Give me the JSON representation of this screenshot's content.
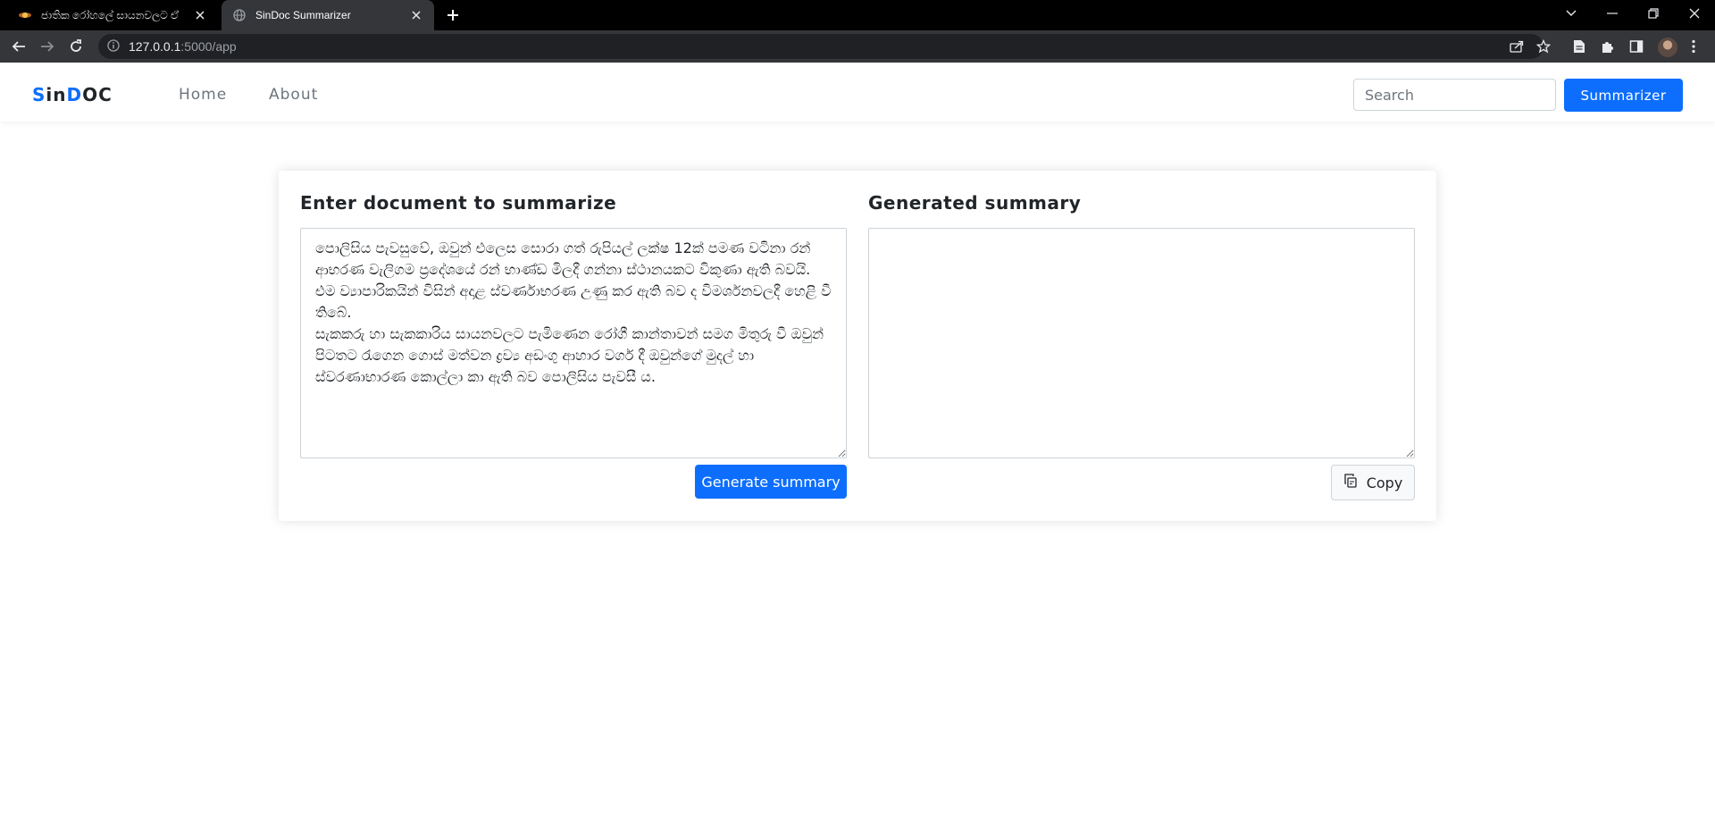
{
  "browser": {
    "tabs": [
      {
        "title": "ජාතික රෝහලේ සායනවලට ඒ",
        "active": false
      },
      {
        "title": "SinDoc Summarizer",
        "active": true
      }
    ],
    "url_host": "127.0.0.1",
    "url_path": ":5000/app"
  },
  "navbar": {
    "brand_highlight_1": "S",
    "brand_part_1": "in",
    "brand_highlight_2": "D",
    "brand_part_2": "OC",
    "links": [
      "Home",
      "About"
    ],
    "search_placeholder": "Search",
    "summarizer_label": "Summarizer"
  },
  "card": {
    "input_heading": "Enter document to summarize",
    "input_text": "පොලිසිය පැවසුවේ, ඔවුන් එලෙස සොරා ගත් රුපියල් ලක්ෂ 12ක් පමණ වටිනා රන් ආභරණ වැලිගම ප්‍රදේශයේ රන් භාණ්ඩ මිලදී ගන්නා ස්ථානයකට විකුණා ඇති බවයි.\nඑම ව්‍යාපාරිකයින් විසින් අදාළ ස්වර්ණාභරණ උණු කර ඇති බව ද විමර්ශනවලදී හෙළි වී තිබේ.\nසැකකරු හා සැකකාරිය සායනවලට පැමිණෙන රෝගී කාන්තාවන් සමග මිතුරු වී ඔවුන් පිටතට රැගෙන ගොස් මත්වන ද්‍රව්‍ය අඩංගු ආහාර වර්ග දී ඔවුන්ගේ මුදල් හා ස්වරණාභාරණ කොල්ලා කා ඇති බව පොලිසිය පැවසී ය.",
    "generate_label": "Generate summary",
    "output_heading": "Generated summary",
    "output_text": "",
    "copy_label": "Copy"
  },
  "colors": {
    "primary": "#0d6efd",
    "chrome_dark": "#000000",
    "chrome_toolbar": "#35363a"
  }
}
